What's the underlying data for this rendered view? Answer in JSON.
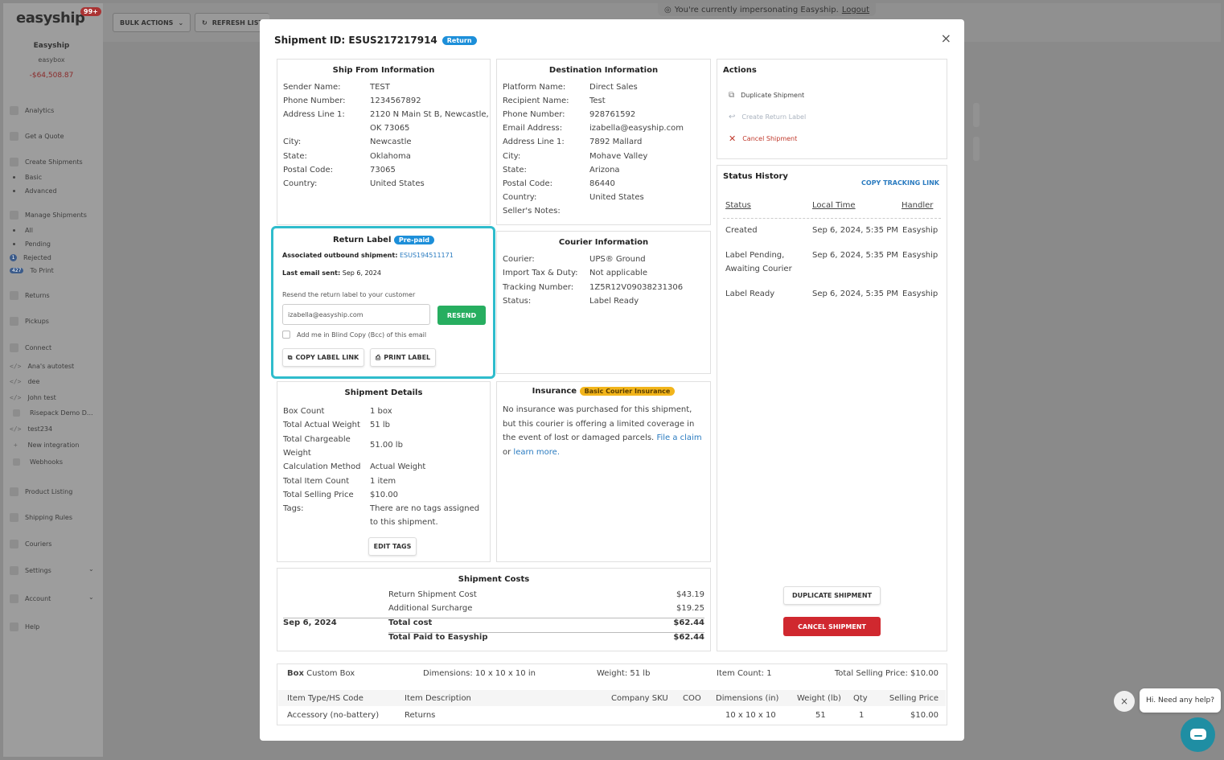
{
  "app": {
    "logo": "easyship",
    "badge": "99+",
    "account_name": "Easyship",
    "account_sub": "easybox",
    "balance": "-$64,508.87"
  },
  "topbar": {
    "bulk_actions": "BULK ACTIONS",
    "refresh": "REFRESH LIST",
    "impersonation": "You're currently impersonating Easyship.",
    "logout": "Logout"
  },
  "sidebar": {
    "analytics": "Analytics",
    "quote": "Get a Quote",
    "create": "Create Shipments",
    "basic": "Basic",
    "advanced": "Advanced",
    "manage": "Manage Shipments",
    "all": "All",
    "pending": "Pending",
    "rejected": "Rejected",
    "rejected_badge": "1",
    "to_print": "To Print",
    "to_print_badge": "427",
    "returns": "Returns",
    "pickups": "Pickups",
    "connect": "Connect",
    "c1": "Ana's autotest",
    "c2": "dee",
    "c3": "John test",
    "c4": "Risepack Demo D...",
    "c5": "test234",
    "c6": "New integration",
    "c7": "Webhooks",
    "listing": "Product Listing",
    "rules": "Shipping Rules",
    "couriers": "Couriers",
    "settings": "Settings",
    "account": "Account",
    "help": "Help",
    "code_glyph": "</>"
  },
  "modal": {
    "title": "Shipment ID: ESUS217217914",
    "title_badge": "Return",
    "close": "×",
    "ship_from": {
      "header": "Ship From Information",
      "rows": [
        {
          "k": "Sender Name:",
          "v": "TEST"
        },
        {
          "k": "Phone Number:",
          "v": "1234567892"
        },
        {
          "k": "Address Line 1:",
          "v": "2120 N Main St B, Newcastle,"
        },
        {
          "k": "",
          "v": "OK 73065"
        },
        {
          "k": "City:",
          "v": "Newcastle"
        },
        {
          "k": "State:",
          "v": "Oklahoma"
        },
        {
          "k": "Postal Code:",
          "v": "73065"
        },
        {
          "k": "Country:",
          "v": "United States"
        }
      ]
    },
    "destination": {
      "header": "Destination Information",
      "rows": [
        {
          "k": "Platform Name:",
          "v": "Direct Sales"
        },
        {
          "k": "Recipient Name:",
          "v": "Test"
        },
        {
          "k": "Phone Number:",
          "v": "928761592"
        },
        {
          "k": "Email Address:",
          "v": "izabella@easyship.com"
        },
        {
          "k": "Address Line 1:",
          "v": "7892 Mallard"
        },
        {
          "k": "City:",
          "v": "Mohave Valley"
        },
        {
          "k": "State:",
          "v": "Arizona"
        },
        {
          "k": "Postal Code:",
          "v": "86440"
        },
        {
          "k": "Country:",
          "v": "United States"
        },
        {
          "k": "Seller's Notes:",
          "v": ""
        }
      ]
    },
    "actions": {
      "header": "Actions",
      "duplicate": "Duplicate Shipment",
      "create_return": "Create Return Label",
      "cancel": "Cancel Shipment"
    },
    "return_label": {
      "header": "Return Label",
      "badge": "Pre-paid",
      "assoc_label": "Associated outbound shipment:",
      "assoc_value": "ESUS194511171",
      "last_email_label": "Last email sent:",
      "last_email_value": "Sep 6, 2024",
      "resend_text": "Resend the return label to your customer",
      "email_value": "izabella@easyship.com",
      "resend_btn": "RESEND",
      "bcc_label": "Add me in Blind Copy (Bcc) of this email",
      "copy_btn": "COPY LABEL LINK",
      "print_btn": "PRINT LABEL"
    },
    "courier": {
      "header": "Courier Information",
      "rows": [
        {
          "k": "Courier:",
          "v": "UPS® Ground"
        },
        {
          "k": "Import Tax & Duty:",
          "v": "Not applicable"
        },
        {
          "k": "Tracking Number:",
          "v": "1Z5R12V09038231306"
        },
        {
          "k": "Status:",
          "v": "Label Ready"
        }
      ]
    },
    "status_history": {
      "header": "Status History",
      "copy_link": "COPY TRACKING LINK",
      "col_status": "Status",
      "col_time": "Local Time",
      "col_handler": "Handler",
      "rows": [
        {
          "status": "Created",
          "status2": "",
          "time": "Sep 6, 2024, 5:35 PM",
          "handler": "Easyship"
        },
        {
          "status": "Label Pending,",
          "status2": "Awaiting Courier",
          "time": "Sep 6, 2024, 5:35 PM",
          "handler": "Easyship"
        },
        {
          "status": "Label Ready",
          "status2": "",
          "time": "Sep 6, 2024, 5:35 PM",
          "handler": "Easyship"
        }
      ],
      "dup_btn": "DUPLICATE SHIPMENT",
      "cancel_btn": "CANCEL SHIPMENT"
    },
    "details": {
      "header": "Shipment Details",
      "rows": [
        {
          "k": "Box Count",
          "v": "1 box"
        },
        {
          "k": "Total Actual Weight",
          "v": "51 lb"
        },
        {
          "k": "Total Chargeable",
          "v": ""
        },
        {
          "k": "Weight",
          "v": ""
        },
        {
          "k": "Calculation Method",
          "v": "Actual Weight"
        },
        {
          "k": "Total Item Count",
          "v": "1 item"
        },
        {
          "k": "Total Selling Price",
          "v": "$10.00"
        },
        {
          "k": "Tags:",
          "v": "There are no tags assigned"
        },
        {
          "k": "",
          "v": "to this shipment."
        }
      ],
      "chargeable_value": "51.00 lb",
      "edit_tags": "EDIT TAGS"
    },
    "insurance": {
      "header": "Insurance",
      "badge": "Basic Courier Insurance",
      "line1": "No insurance was purchased for this shipment,",
      "line2": "but this courier is offering a limited coverage in",
      "line3": "the event of lost or damaged parcels.",
      "file_claim": "File a claim",
      "or": "or",
      "learn_more": "learn more",
      "period": "."
    },
    "costs": {
      "header": "Shipment Costs",
      "return_label": "Return Shipment Cost",
      "return_value": "$43.19",
      "surcharge_label": "Additional Surcharge",
      "surcharge_value": "$19.25",
      "date": "Sep 6, 2024",
      "total_label": "Total cost",
      "total_value": "$62.44",
      "paid_label": "Total Paid to Easyship",
      "paid_value": "$62.44"
    },
    "box": {
      "box_bold": "Box",
      "box_name": "Custom Box",
      "dimensions": "Dimensions: 10 x 10 x 10 in",
      "weight": "Weight: 51 lb",
      "item_count": "Item Count: 1",
      "selling": "Total Selling Price: $10.00",
      "headers": [
        "Item Type/HS Code",
        "Item Description",
        "Company SKU",
        "COO",
        "Dimensions (in)",
        "Weight (lb)",
        "Qty",
        "Selling Price"
      ],
      "row": [
        "Accessory (no-battery)",
        "Returns",
        "",
        "",
        "10 x 10 x 10",
        "51",
        "1",
        "$10.00"
      ]
    }
  },
  "chat": {
    "bubble": "Hi. Need any help?",
    "close": "×"
  }
}
